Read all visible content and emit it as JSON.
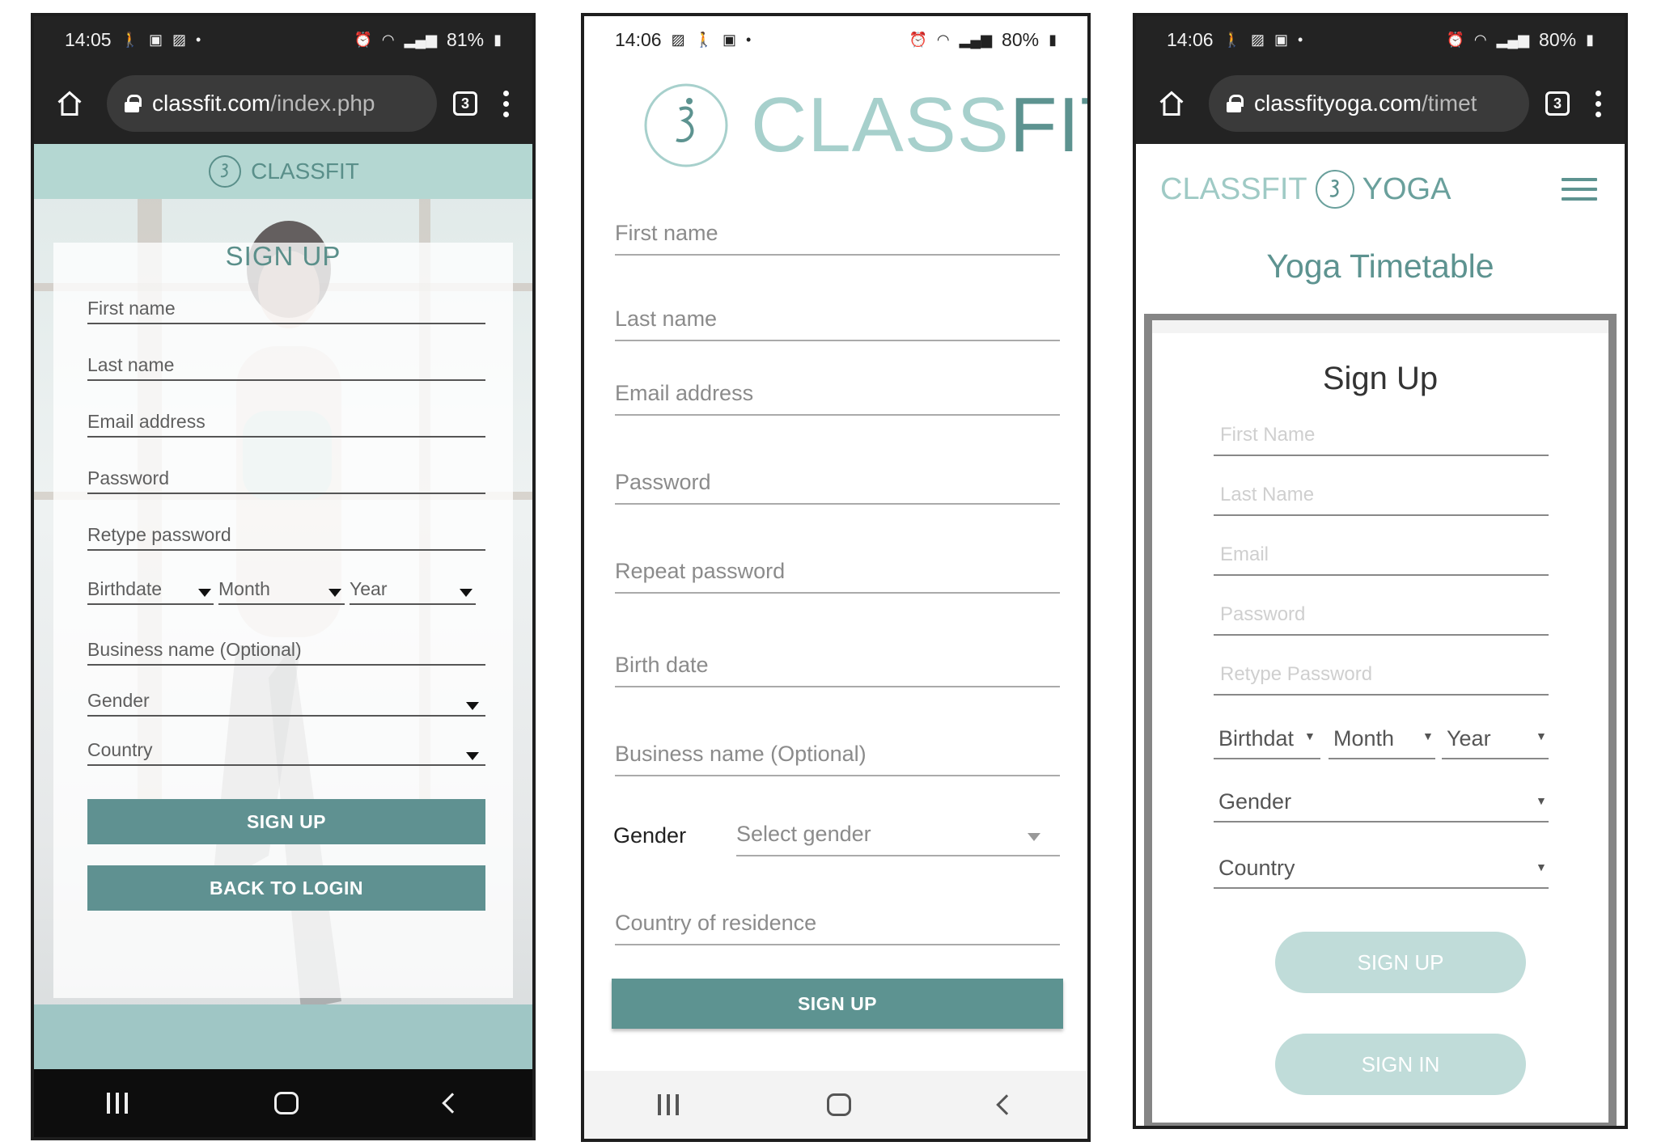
{
  "phone1": {
    "status": {
      "time": "14:05",
      "battery": "81%"
    },
    "url": {
      "host": "classfit.com",
      "path": "/index.php",
      "tab_count": "3"
    },
    "brand": "CLASSFIT",
    "title": "SIGN UP",
    "fields": {
      "first_name": "First name",
      "last_name": "Last name",
      "email": "Email address",
      "password": "Password",
      "retype_password": "Retype password",
      "birthdate": "Birthdate",
      "month": "Month",
      "year": "Year",
      "business": "Business name  (Optional)",
      "gender": "Gender",
      "country": "Country"
    },
    "buttons": {
      "signup": "SIGN UP",
      "back_to_login": "BACK TO LOGIN"
    },
    "accent": "#5f9191"
  },
  "phone2": {
    "status": {
      "time": "14:06",
      "battery": "80%"
    },
    "brand": {
      "part1": "CLASS",
      "part2": "FIT"
    },
    "fields": {
      "first_name": "First name",
      "last_name": "Last name",
      "email": "Email address",
      "password": "Password",
      "repeat_password": "Repeat password",
      "birth_date": "Birth date",
      "business": "Business name (Optional)",
      "gender_label": "Gender",
      "gender_placeholder": "Select gender",
      "country": "Country of residence"
    },
    "buttons": {
      "signup": "SIGN UP"
    },
    "accent": "#5d9391"
  },
  "phone3": {
    "status": {
      "time": "14:06",
      "battery": "80%"
    },
    "url": {
      "host": "classfityoga.com",
      "path": "/timet",
      "tab_count": "3"
    },
    "brand": {
      "part1": "CLASSFIT",
      "part2": "YOGA"
    },
    "page_title": "Yoga Timetable",
    "form_title": "Sign Up",
    "fields": {
      "first_name": "First Name",
      "last_name": "Last Name",
      "email": "Email",
      "password": "Password",
      "retype_password": "Retype Password",
      "birthdate": "Birthdat",
      "month": "Month",
      "year": "Year",
      "gender": "Gender",
      "country": "Country"
    },
    "buttons": {
      "signup": "SIGN UP",
      "signin": "SIGN IN"
    },
    "accent": "#c0dcd9"
  }
}
